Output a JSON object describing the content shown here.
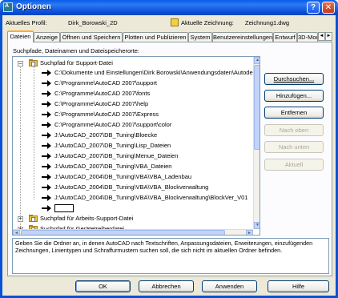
{
  "window": {
    "title": "Optionen",
    "icon_label": "A",
    "help_glyph": "?",
    "close_glyph": "✕"
  },
  "profile": {
    "current_profile_label": "Aktuelles Profil:",
    "current_profile_value": "Dirk_Borowski_2D",
    "current_drawing_label": "Aktuelle Zeichnung:",
    "current_drawing_value": "Zeichnung1.dwg"
  },
  "tabs": [
    {
      "label": "Dateien",
      "active": true
    },
    {
      "label": "Anzeige"
    },
    {
      "label": "Öffnen und Speichern"
    },
    {
      "label": "Plotten und Publizieren"
    },
    {
      "label": "System"
    },
    {
      "label": "Benutzereinstellungen"
    },
    {
      "label": "Entwurf"
    },
    {
      "label": "3D-Mod"
    }
  ],
  "tab_scroll": {
    "left": "◄",
    "right": "►"
  },
  "panel": {
    "label": "Suchpfade, Dateinamen und Dateispeicherorte:"
  },
  "tree": {
    "root": {
      "label": "Suchpfad für Support-Datei",
      "expander": "–"
    },
    "paths": [
      "C:\\Dokumente und Einstellungen\\Dirk Borowski\\Anwendungsdaten\\Autode",
      "C:\\Programme\\AutoCAD 2007\\support",
      "C:\\Programme\\AutoCAD 2007\\fonts",
      "C:\\Programme\\AutoCAD 2007\\help",
      "C:\\Programme\\AutoCAD 2007\\Express",
      "C:\\Programme\\AutoCAD 2007\\support\\color",
      "J:\\AutoCAD_2007\\DB_Tuning\\Bloecke",
      "J:\\AutoCAD_2007\\DB_Tuning\\Lisp_Dateien",
      "J:\\AutoCAD_2007\\DB_Tuning\\Menue_Dateien",
      "J:\\AutoCAD_2007\\DB_Tuning\\VBA_Dateien",
      "J:\\AutoCAD_2004\\DB_Tuning\\VBA\\VBA_Ladenbau",
      "J:\\AutoCAD_2004\\DB_Tuning\\VBA\\VBA_Blockverwaltung",
      "J:\\AutoCAD_2004\\DB_Tuning\\VBA\\VBA_Blockverwaltung\\BlockVer_V01"
    ],
    "other_nodes": [
      {
        "label": "Suchpfad für Arbeits-Support-Datei",
        "expander": "+"
      },
      {
        "label": "Suchpfad für Gerätetreiberdatei",
        "expander": "+"
      }
    ]
  },
  "side_buttons": [
    {
      "label": "Durchsuchen...",
      "name": "browse-button",
      "enabled": true
    },
    {
      "label": "Hinzufügen...",
      "name": "add-button",
      "enabled": true
    },
    {
      "label": "Entfernen",
      "name": "remove-button",
      "enabled": true
    },
    {
      "label": "Nach oben",
      "name": "move-up-button",
      "enabled": false
    },
    {
      "label": "Nach unten",
      "name": "move-down-button",
      "enabled": false
    },
    {
      "label": "Aktuell",
      "name": "set-current-button",
      "enabled": false
    }
  ],
  "description": "Geben Sie die Ordner an, in denen AutoCAD nach Textschriften, Anpassungsdateien, Erweiterungen, einzufügenden Zeichnungen, Linientypen und Schraffurmustern suchen soll, die sich nicht im aktuellen Ordner befinden.",
  "bottom_buttons": {
    "ok": "OK",
    "cancel": "Abbrechen",
    "apply": "Anwenden",
    "help": "Hilfe"
  }
}
